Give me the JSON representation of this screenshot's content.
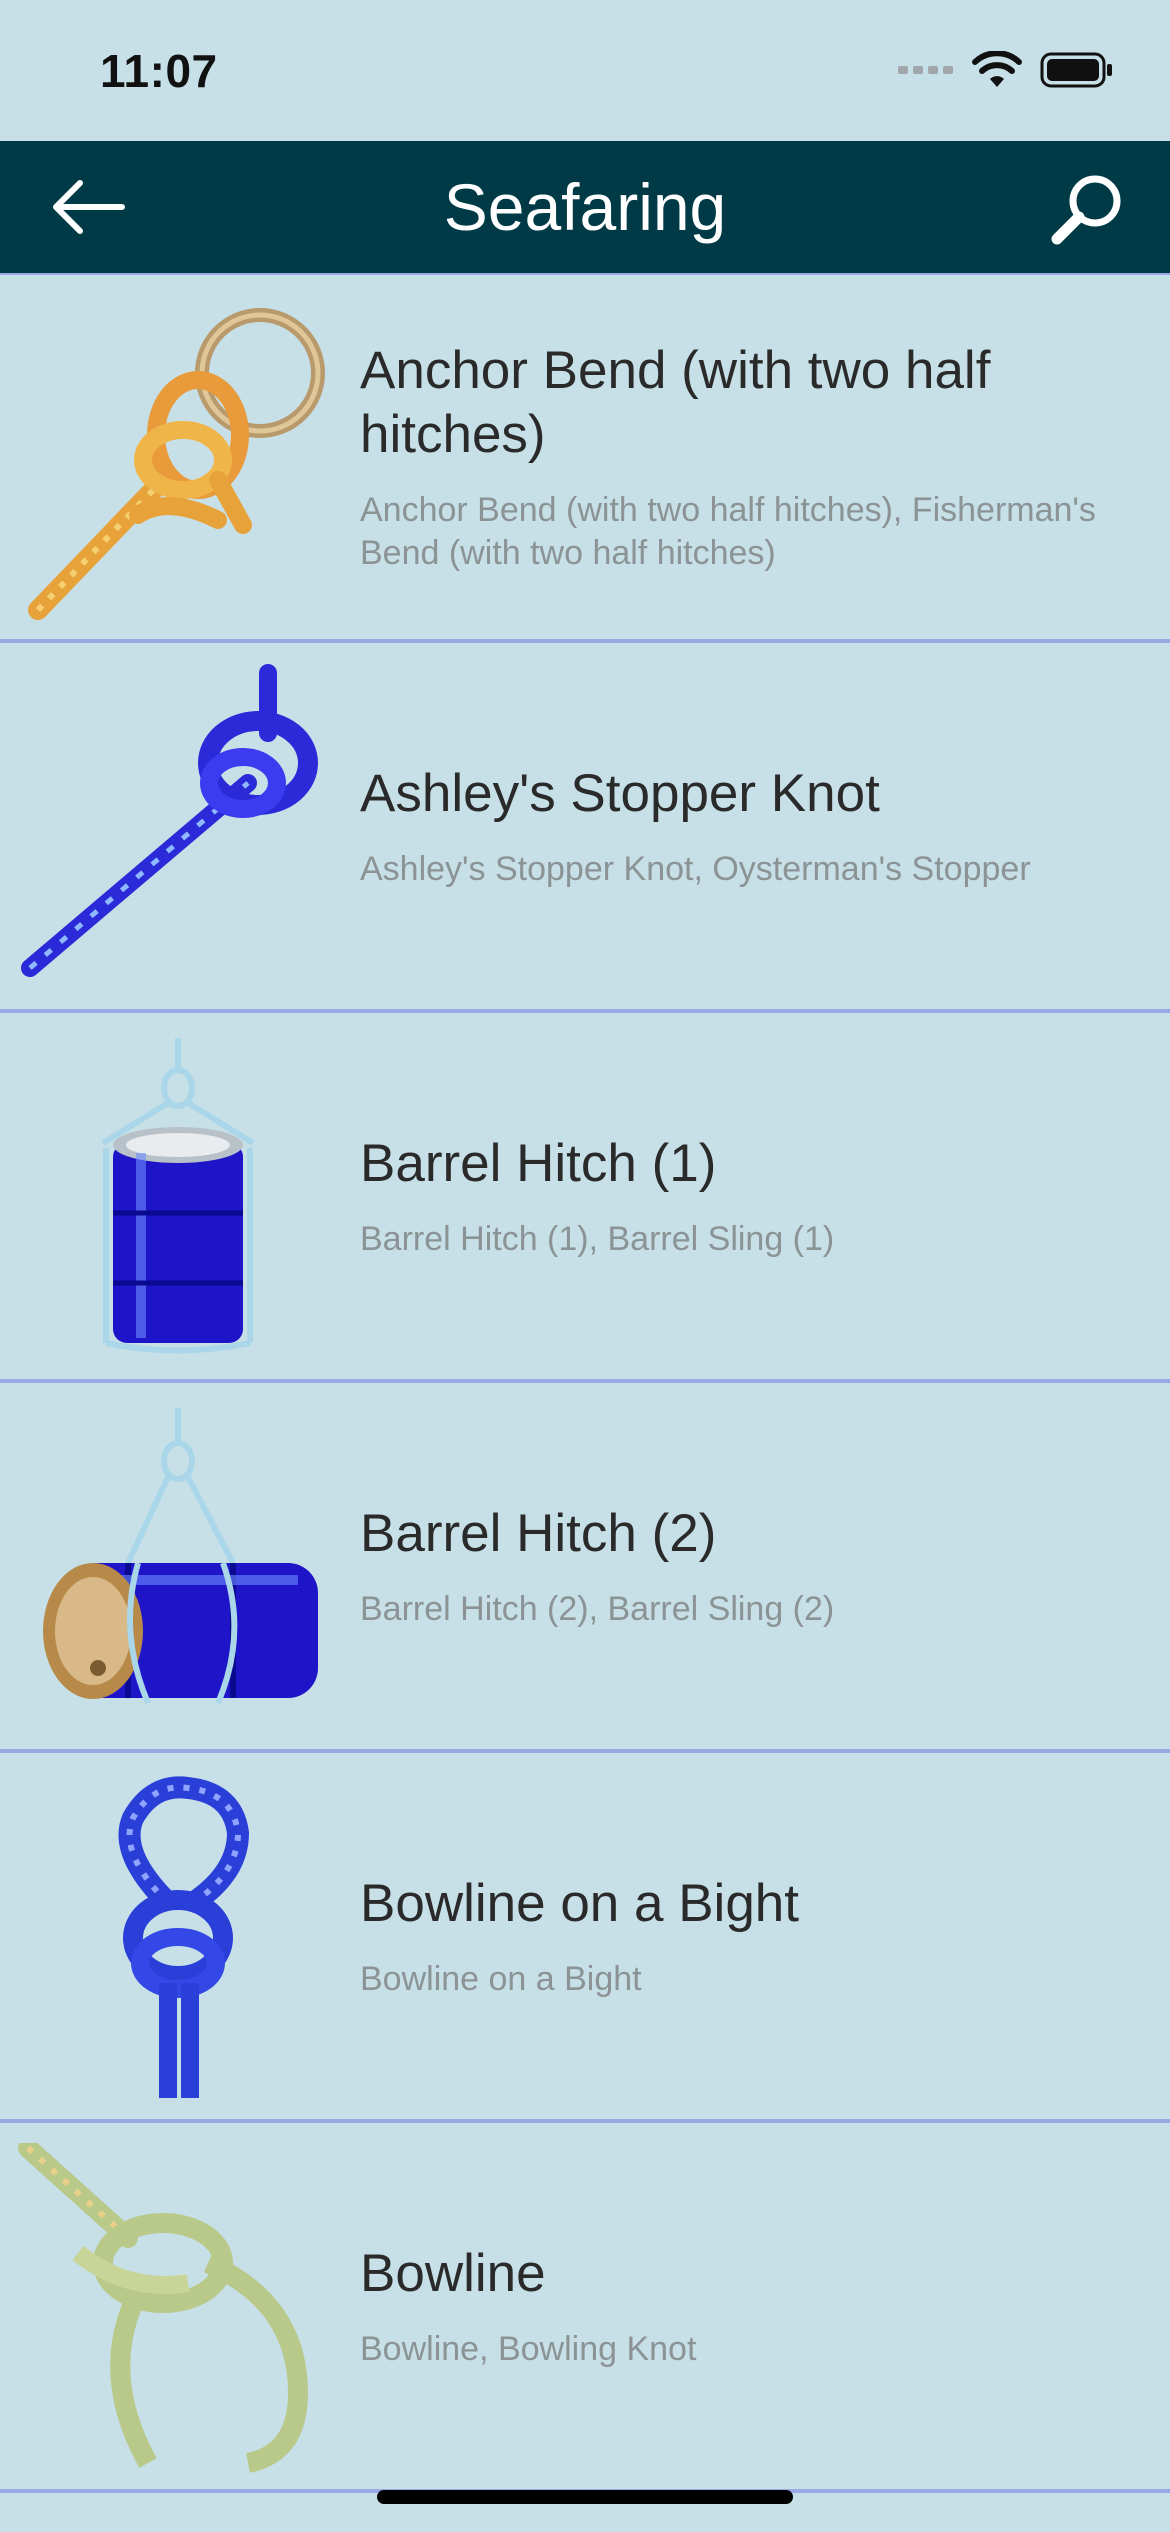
{
  "status_bar": {
    "time": "11:07",
    "icons": [
      "cellular-signal-icon",
      "wifi-icon",
      "battery-icon"
    ]
  },
  "nav": {
    "title": "Seafaring",
    "back_icon": "arrow-left-icon",
    "search_icon": "magnifier-icon",
    "background": "#003a46"
  },
  "list": {
    "items": [
      {
        "title": "Anchor Bend (with two half hitches)",
        "subtitle": "Anchor Bend (with two half hitches), Fisherman's Bend (with two half hitches)",
        "image": "anchor-bend-knot-icon"
      },
      {
        "title": "Ashley's Stopper Knot",
        "subtitle": "Ashley's Stopper Knot, Oysterman's Stopper",
        "image": "ashleys-stopper-knot-icon"
      },
      {
        "title": "Barrel Hitch (1)",
        "subtitle": "Barrel Hitch (1), Barrel Sling (1)",
        "image": "barrel-hitch-upright-icon"
      },
      {
        "title": "Barrel Hitch (2)",
        "subtitle": "Barrel Hitch (2), Barrel Sling (2)",
        "image": "barrel-hitch-horizontal-icon"
      },
      {
        "title": "Bowline on a Bight",
        "subtitle": "Bowline on a Bight",
        "image": "bowline-on-a-bight-knot-icon"
      },
      {
        "title": "Bowline",
        "subtitle": "Bowline, Bowling Knot",
        "image": "bowline-knot-icon"
      }
    ]
  },
  "colors": {
    "background": "#c7e0e8",
    "separator": "#9ba8e6",
    "title_text": "#2a2a2a",
    "subtitle_text": "#8b9395"
  }
}
